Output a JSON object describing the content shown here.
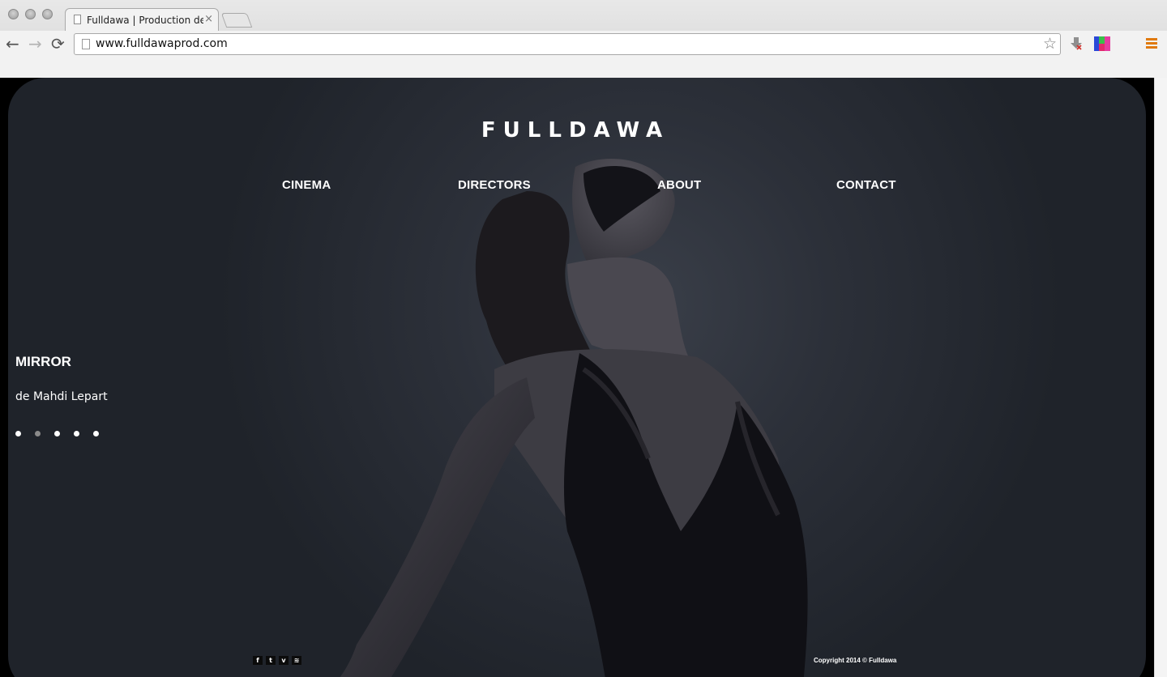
{
  "browser": {
    "tab_title": "Fulldawa | Production de c",
    "tab_close": "×",
    "back": "←",
    "forward": "→",
    "reload": "⟳",
    "url": "www.fulldawaprod.com",
    "star": "☆"
  },
  "site": {
    "logo": "FULLDAWA",
    "nav": [
      {
        "label": "CINEMA"
      },
      {
        "label": "DIRECTORS"
      },
      {
        "label": "ABOUT"
      },
      {
        "label": "CONTACT"
      }
    ],
    "slide": {
      "title": "MIRROR",
      "subtitle": "de Mahdi Lepart",
      "dots": 5,
      "active_dot_index": 1
    },
    "social": [
      {
        "name": "facebook-icon",
        "glyph": "f"
      },
      {
        "name": "twitter-icon",
        "glyph": "t"
      },
      {
        "name": "vimeo-icon",
        "glyph": "v"
      },
      {
        "name": "rss-icon",
        "glyph": "≋"
      }
    ],
    "copyright": "Copyright 2014 © Fulldawa"
  }
}
